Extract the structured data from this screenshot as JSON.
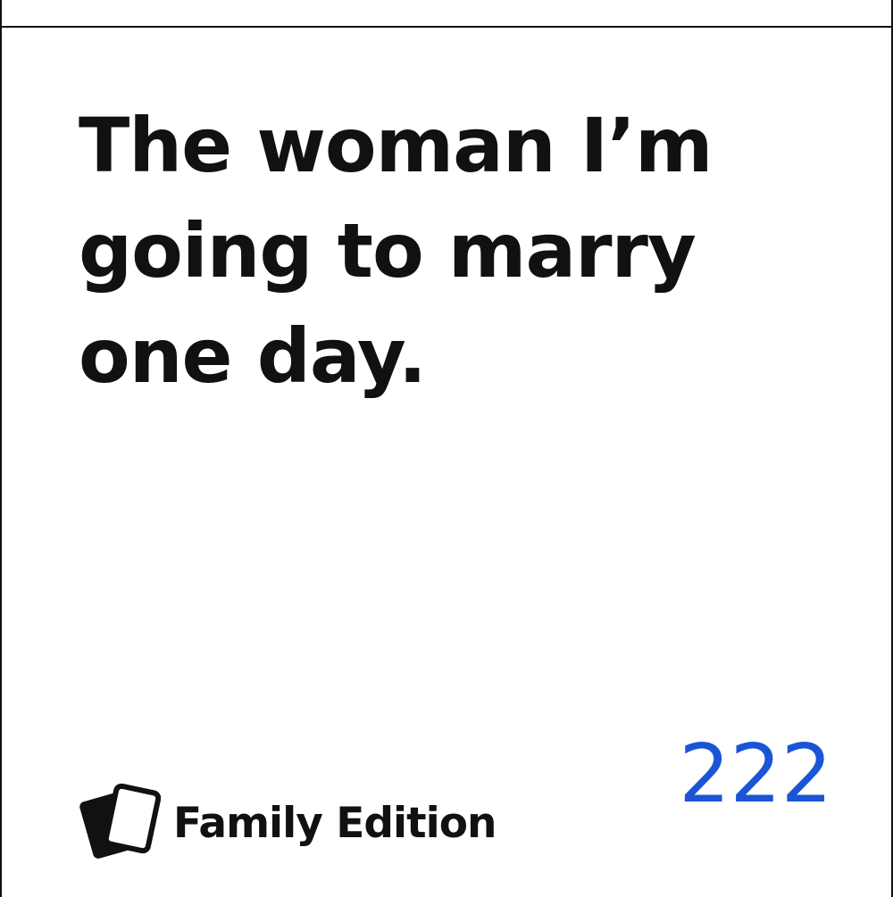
{
  "card": {
    "text_lines": [
      "The woman I’m",
      "going to marry",
      "one day."
    ],
    "number": "222",
    "number_color": "#1a55d6",
    "text_color": "#111111",
    "border_color": "#111111"
  },
  "brand": {
    "name": "Family Edition",
    "logo_icon": "two-cards-icon"
  }
}
